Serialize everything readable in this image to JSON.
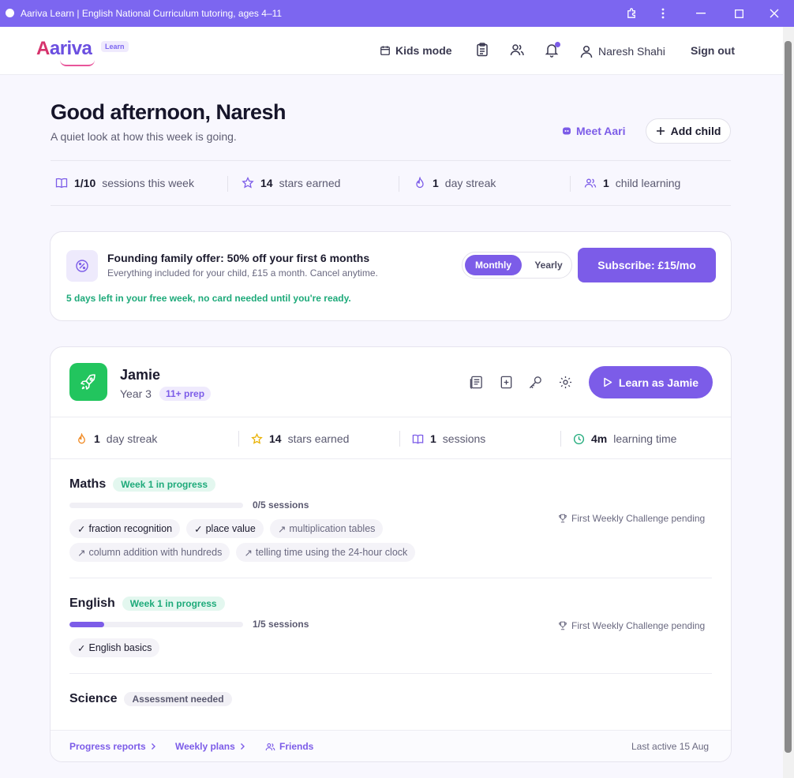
{
  "window": {
    "title": "Aariva Learn | English National Curriculum tutoring, ages 4–11"
  },
  "header": {
    "logo": "Aariva",
    "logo_badge": "Learn",
    "kids_mode": "Kids mode",
    "user_name": "Naresh Shahi",
    "sign_out": "Sign out"
  },
  "greeting": {
    "title": "Good afternoon, Naresh",
    "subtitle": "A quiet look at how this week is going.",
    "meet_aari": "Meet Aari",
    "add_child": "Add child"
  },
  "stats": [
    {
      "value": "1/10",
      "label": "sessions this week",
      "icon": "book-icon"
    },
    {
      "value": "14",
      "label": "stars earned",
      "icon": "star-icon"
    },
    {
      "value": "1",
      "label": "day streak",
      "icon": "flame-icon"
    },
    {
      "value": "1",
      "label": "child learning",
      "icon": "users-icon"
    }
  ],
  "offer": {
    "title": "Founding family offer: 50% off your first 6 months",
    "subtitle": "Everything included for your child, £15 a month. Cancel anytime.",
    "note": "5 days left in your free week, no card needed until you're ready.",
    "toggle_monthly": "Monthly",
    "toggle_yearly": "Yearly",
    "subscribe": "Subscribe: £15/mo"
  },
  "child": {
    "name": "Jamie",
    "year": "Year 3",
    "badge": "11+ prep",
    "learn_button": "Learn as Jamie",
    "stats": [
      {
        "value": "1",
        "label": "day streak"
      },
      {
        "value": "14",
        "label": "stars earned"
      },
      {
        "value": "1",
        "label": "sessions"
      },
      {
        "value": "4m",
        "label": "learning time"
      }
    ],
    "subjects": {
      "maths": {
        "name": "Maths",
        "status": "Week 1 in progress",
        "sessions": "0/5 sessions",
        "progress": 0,
        "challenge": "First Weekly Challenge pending",
        "chips": [
          {
            "mark": "✓",
            "text": "fraction recognition"
          },
          {
            "mark": "✓",
            "text": "place value"
          },
          {
            "mark": "↗",
            "text": "multiplication tables"
          },
          {
            "mark": "↗",
            "text": "column addition with hundreds"
          },
          {
            "mark": "↗",
            "text": "telling time using the 24-hour clock"
          }
        ]
      },
      "english": {
        "name": "English",
        "status": "Week 1 in progress",
        "sessions": "1/5 sessions",
        "progress": 0.2,
        "challenge": "First Weekly Challenge pending",
        "chips": [
          {
            "mark": "✓",
            "text": "English basics"
          }
        ]
      },
      "science": {
        "name": "Science",
        "status": "Assessment needed"
      }
    },
    "footer": {
      "progress_reports": "Progress reports",
      "weekly_plans": "Weekly plans",
      "friends": "Friends",
      "last_active": "Last active 15 Aug"
    }
  },
  "colors": {
    "accent": "#7c5ce8",
    "green": "#1eaa7a",
    "titlebar": "#7c66f0"
  }
}
